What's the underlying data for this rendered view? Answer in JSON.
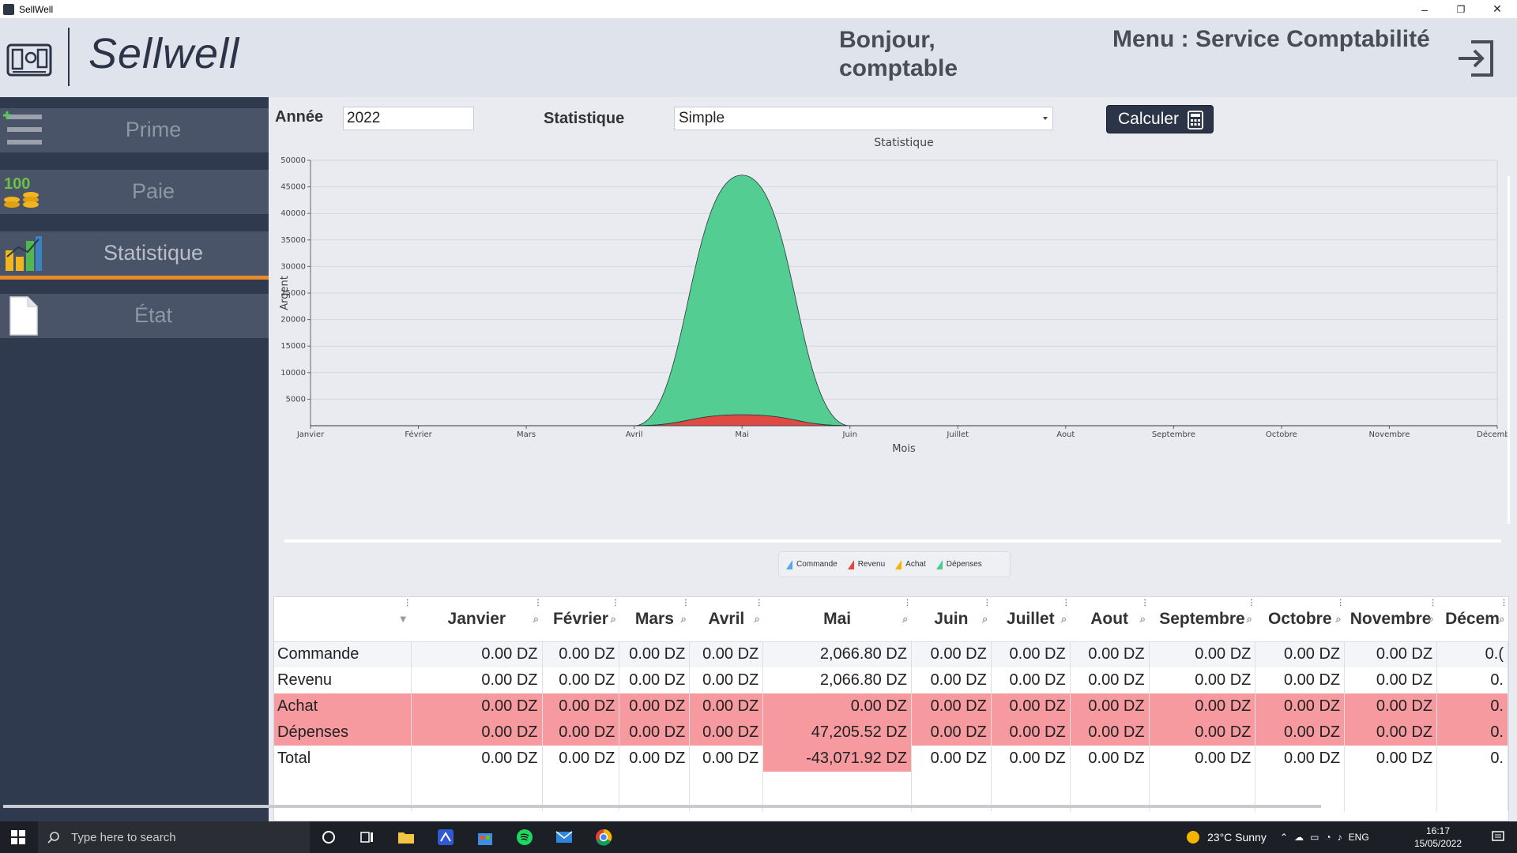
{
  "window": {
    "title": "SellWell"
  },
  "header": {
    "logo_text": "Sellwell",
    "greeting_line1": "Bonjour,",
    "greeting_line2": "comptable",
    "menu_title": "Menu : Service Comptabilité"
  },
  "sidebar": {
    "items": [
      {
        "label": "Prime",
        "icon": "list-add-icon",
        "active": false
      },
      {
        "label": "Paie",
        "icon": "coins-icon",
        "active": false
      },
      {
        "label": "Statistique",
        "icon": "bar-chart-icon",
        "active": true
      },
      {
        "label": "État",
        "icon": "document-icon",
        "active": false
      }
    ]
  },
  "controls": {
    "year_label": "Année",
    "year_value": "2022",
    "stat_label": "Statistique",
    "stat_value": "Simple",
    "calc_label": "Calculer"
  },
  "chart_data": {
    "type": "area",
    "title": "Statistique",
    "xlabel": "Mois",
    "ylabel": "Argent",
    "categories": [
      "Janvier",
      "Février",
      "Mars",
      "Avril",
      "Mai",
      "Juin",
      "Juillet",
      "Aout",
      "Septembre",
      "Octobre",
      "Novembre",
      "Décembre"
    ],
    "yticks": [
      5000,
      10000,
      15000,
      20000,
      25000,
      30000,
      35000,
      40000,
      45000,
      50000
    ],
    "ylim": [
      0,
      50000
    ],
    "grid": true,
    "legend_position": "bottom",
    "series": [
      {
        "name": "Commande",
        "color": "#5aa7f0",
        "values": [
          0,
          0,
          0,
          0,
          2066.8,
          0,
          0,
          0,
          0,
          0,
          0,
          0
        ]
      },
      {
        "name": "Revenu",
        "color": "#e8453c",
        "values": [
          0,
          0,
          0,
          0,
          2066.8,
          0,
          0,
          0,
          0,
          0,
          0,
          0
        ]
      },
      {
        "name": "Achat",
        "color": "#f4b400",
        "values": [
          0,
          0,
          0,
          0,
          0,
          0,
          0,
          0,
          0,
          0,
          0,
          0
        ]
      },
      {
        "name": "Dépenses",
        "color": "#4ccb8c",
        "values": [
          0,
          0,
          0,
          0,
          47205.52,
          0,
          0,
          0,
          0,
          0,
          0,
          0
        ]
      }
    ]
  },
  "table": {
    "columns": [
      "",
      "Janvier",
      "Février",
      "Mars",
      "Avril",
      "Mai",
      "Juin",
      "Juillet",
      "Aout",
      "Septembre",
      "Octobre",
      "Novembre",
      "Décem"
    ],
    "rows": [
      {
        "label": "Commande",
        "values": [
          "0.00 DZ",
          "0.00 DZ",
          "0.00 DZ",
          "0.00 DZ",
          "2,066.80 DZ",
          "0.00 DZ",
          "0.00 DZ",
          "0.00 DZ",
          "0.00 DZ",
          "0.00 DZ",
          "0.00 DZ",
          "0.("
        ]
      },
      {
        "label": "Revenu",
        "values": [
          "0.00 DZ",
          "0.00 DZ",
          "0.00 DZ",
          "0.00 DZ",
          "2,066.80 DZ",
          "0.00 DZ",
          "0.00 DZ",
          "0.00 DZ",
          "0.00 DZ",
          "0.00 DZ",
          "0.00 DZ",
          "0."
        ]
      },
      {
        "label": "Achat",
        "values": [
          "0.00 DZ",
          "0.00 DZ",
          "0.00 DZ",
          "0.00 DZ",
          "0.00 DZ",
          "0.00 DZ",
          "0.00 DZ",
          "0.00 DZ",
          "0.00 DZ",
          "0.00 DZ",
          "0.00 DZ",
          "0."
        ]
      },
      {
        "label": "Dépenses",
        "values": [
          "0.00 DZ",
          "0.00 DZ",
          "0.00 DZ",
          "0.00 DZ",
          "47,205.52 DZ",
          "0.00 DZ",
          "0.00 DZ",
          "0.00 DZ",
          "0.00 DZ",
          "0.00 DZ",
          "0.00 DZ",
          "0."
        ]
      },
      {
        "label": "Total",
        "values": [
          "0.00 DZ",
          "0.00 DZ",
          "0.00 DZ",
          "0.00 DZ",
          "-43,071.92 DZ",
          "0.00 DZ",
          "0.00 DZ",
          "0.00 DZ",
          "0.00 DZ",
          "0.00 DZ",
          "0.00 DZ",
          "0."
        ]
      }
    ]
  },
  "taskbar": {
    "search_placeholder": "Type here to search",
    "weather": "23°C  Sunny",
    "lang": "ENG",
    "time": "16:17",
    "date": "15/05/2022"
  }
}
